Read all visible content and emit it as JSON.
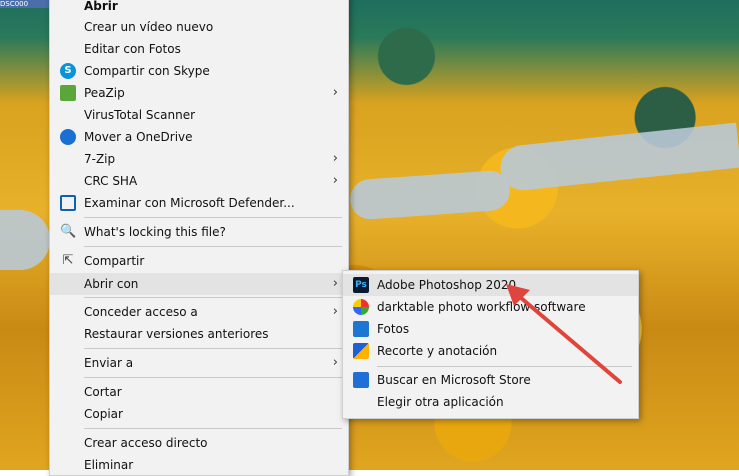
{
  "file_label": "DSC000",
  "context_menu": {
    "items": [
      {
        "label": "Abrir",
        "bold": true,
        "icon": null,
        "submenu": false
      },
      {
        "label": "Crear un vídeo nuevo",
        "icon": null,
        "submenu": false
      },
      {
        "label": "Editar con Fotos",
        "icon": null,
        "submenu": false
      },
      {
        "label": "Compartir con Skype",
        "icon": "skype-icon",
        "submenu": false
      },
      {
        "label": "PeaZip",
        "icon": "peazip-icon",
        "submenu": true
      },
      {
        "label": "VirusTotal Scanner",
        "icon": null,
        "submenu": false
      },
      {
        "label": "Mover a OneDrive",
        "icon": "onedrive-cloud-icon",
        "submenu": false
      },
      {
        "label": "7-Zip",
        "icon": null,
        "submenu": true
      },
      {
        "label": "CRC SHA",
        "icon": null,
        "submenu": true
      },
      {
        "label": "Examinar con Microsoft Defender...",
        "icon": "defender-shield-icon",
        "submenu": false
      },
      {
        "label": "What's locking this file?",
        "icon": "lock-search-icon",
        "submenu": false
      },
      {
        "label": "Compartir",
        "icon": "share-icon",
        "submenu": false
      },
      {
        "label": "Abrir con",
        "icon": null,
        "submenu": true,
        "highlighted": true
      },
      {
        "label": "Conceder acceso a",
        "icon": null,
        "submenu": true
      },
      {
        "label": "Restaurar versiones anteriores",
        "icon": null,
        "submenu": false
      },
      {
        "label": "Enviar a",
        "icon": null,
        "submenu": true
      },
      {
        "label": "Cortar",
        "icon": null,
        "submenu": false
      },
      {
        "label": "Copiar",
        "icon": null,
        "submenu": false
      },
      {
        "label": "Crear acceso directo",
        "icon": null,
        "submenu": false
      },
      {
        "label": "Eliminar",
        "icon": null,
        "submenu": false
      }
    ]
  },
  "open_with_submenu": {
    "items": [
      {
        "label": "Adobe Photoshop 2020",
        "icon": "photoshop-icon",
        "highlighted": true
      },
      {
        "label": "darktable photo workflow software",
        "icon": "darktable-icon"
      },
      {
        "label": "Fotos",
        "icon": "photos-icon"
      },
      {
        "label": "Recorte y anotación",
        "icon": "snip-sketch-icon"
      },
      {
        "label": "Buscar en Microsoft Store",
        "icon": "store-icon"
      },
      {
        "label": "Elegir otra aplicación",
        "icon": null
      }
    ]
  },
  "colors": {
    "menu_bg": "#f2f2f2",
    "highlight": "#e3e3e3",
    "arrow": "#e0453d"
  }
}
